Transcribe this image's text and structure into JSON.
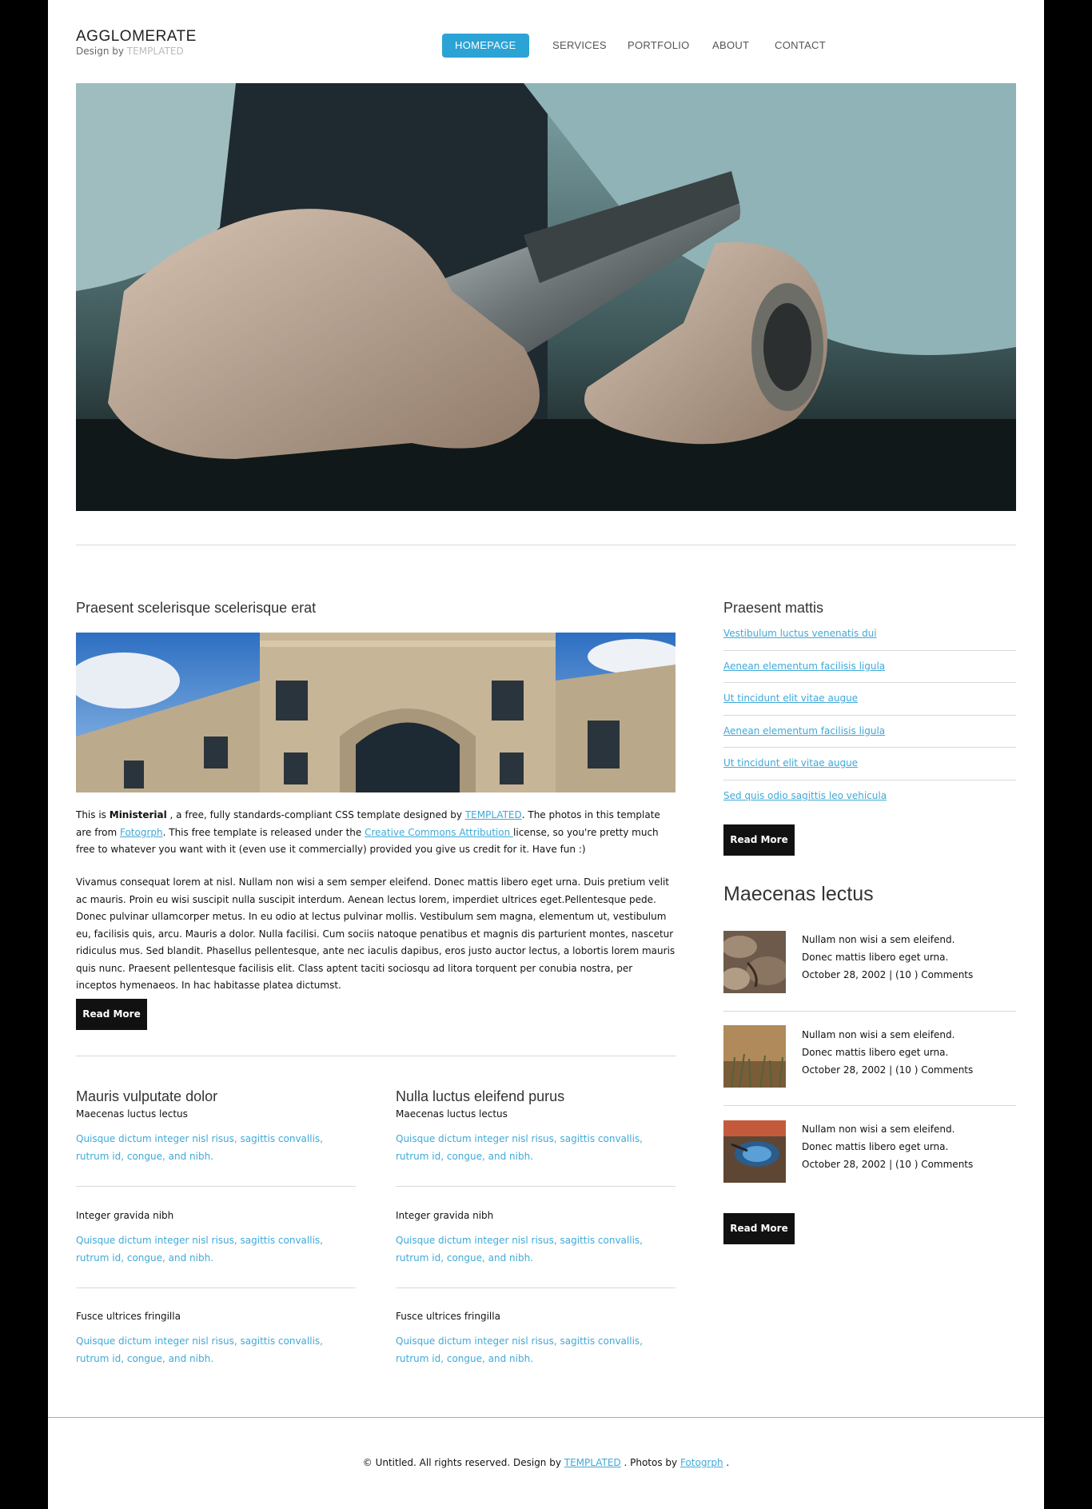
{
  "header": {
    "logo_title": "AGGLOMERATE",
    "logo_design_by": "Design by",
    "logo_templated": "TEMPLATED",
    "nav": [
      "HOMEPAGE",
      "SERVICES",
      "PORTFOLIO",
      "ABOUT",
      "CONTACT"
    ],
    "active_nav": "HOMEPAGE"
  },
  "main": {
    "title": "Praesent scelerisque scelerisque erat",
    "intro": {
      "t1": "This is ",
      "bold": "Ministerial",
      "t2": " , a free, fully standards-compliant CSS template designed by ",
      "link1": "TEMPLATED",
      "t3": ". The photos in this template are from ",
      "link2": "Fotogrph",
      "t4": ". This free template is released under the ",
      "link3": "Creative Commons Attribution ",
      "t5": "license, so you're pretty much free to whatever you want with it (even use it commercially) provided you give us credit for it. Have fun :)"
    },
    "paragraph": "Vivamus consequat lorem at nisl. Nullam non wisi a sem semper eleifend. Donec mattis libero eget urna. Duis pretium velit ac mauris. Proin eu wisi suscipit nulla suscipit interdum. Aenean lectus lorem, imperdiet ultrices eget.Pellentesque pede. Donec pulvinar ullamcorper metus. In eu odio at lectus pulvinar mollis. Vestibulum sem magna, elementum ut, vestibulum eu, facilisis quis, arcu. Mauris a dolor. Nulla facilisi. Cum sociis natoque penatibus et magnis dis parturient montes, nascetur ridiculus mus. Sed blandit. Phasellus pellentesque, ante nec iaculis dapibus, eros justo auctor lectus, a lobortis lorem mauris quis nunc. Praesent pellentesque facilisis elit. Class aptent taciti sociosqu ad litora torquent per conubia nostra, per inceptos hymenaeos. In hac habitasse platea dictumst.",
    "read_more": "Read More"
  },
  "columns": [
    {
      "title": "Mauris vulputate dolor",
      "items": [
        {
          "label": "Maecenas luctus lectus",
          "text": "Quisque dictum integer nisl risus, sagittis convallis, rutrum id, congue, and nibh."
        },
        {
          "label": "Integer gravida nibh",
          "text": "Quisque dictum integer nisl risus, sagittis convallis, rutrum id, congue, and nibh."
        },
        {
          "label": "Fusce ultrices fringilla",
          "text": "Quisque dictum integer nisl risus, sagittis convallis, rutrum id, congue, and nibh."
        }
      ]
    },
    {
      "title": "Nulla luctus eleifend purus",
      "items": [
        {
          "label": "Maecenas luctus lectus",
          "text": "Quisque dictum integer nisl risus, sagittis convallis, rutrum id, congue, and nibh."
        },
        {
          "label": "Integer gravida nibh",
          "text": "Quisque dictum integer nisl risus, sagittis convallis, rutrum id, congue, and nibh."
        },
        {
          "label": "Fusce ultrices fringilla",
          "text": "Quisque dictum integer nisl risus, sagittis convallis, rutrum id, congue, and nibh."
        }
      ]
    }
  ],
  "sidebar": {
    "title": "Praesent mattis",
    "links": [
      "Vestibulum luctus venenatis dui",
      "Aenean elementum facilisis ligula",
      "Ut tincidunt elit vitae augue",
      "Aenean elementum facilisis ligula",
      "Ut tincidunt elit vitae augue",
      "Sed quis odio sagittis leo vehicula"
    ],
    "read_more": "Read More",
    "news_title": "Maecenas lectus",
    "news": [
      {
        "line1": "Nullam non wisi a sem eleifend.",
        "line2": "Donec mattis libero eget urna.",
        "line3": "October 28, 2002 | (10 ) Comments"
      },
      {
        "line1": "Nullam non wisi a sem eleifend.",
        "line2": "Donec mattis libero eget urna.",
        "line3": "October 28, 2002 | (10 ) Comments"
      },
      {
        "line1": "Nullam non wisi a sem eleifend.",
        "line2": "Donec mattis libero eget urna.",
        "line3": "October 28, 2002 | (10 ) Comments"
      }
    ],
    "news_read_more": "Read More"
  },
  "footer": {
    "t1": "© Untitled. All rights reserved. Design by ",
    "link1": "TEMPLATED",
    "t2": " . Photos by ",
    "link2": "Fotogrph",
    "t3": " ."
  },
  "colors": {
    "accent": "#2ba3d5",
    "link": "#3fa9d8",
    "button": "#111111",
    "outer": "#000000"
  }
}
